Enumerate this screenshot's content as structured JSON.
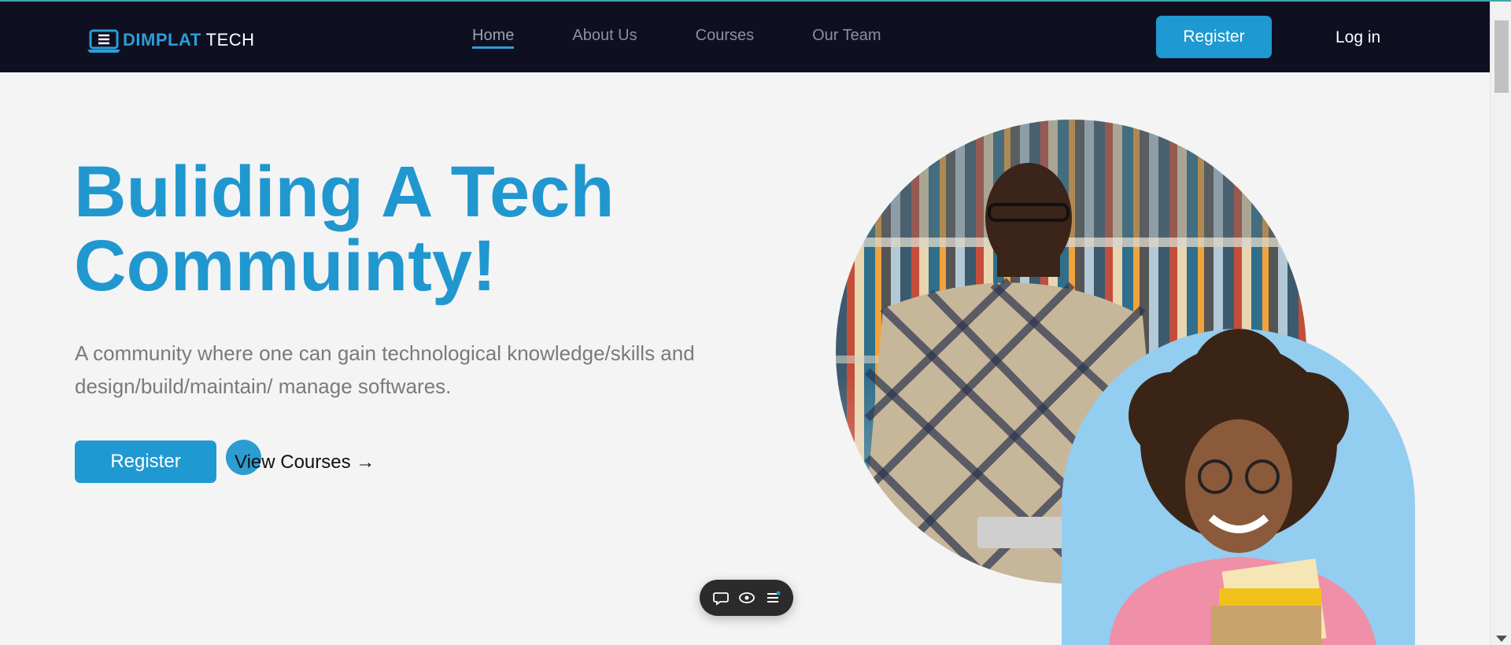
{
  "header": {
    "logo": {
      "word1": "DIMPLAT",
      "word2": "TECH"
    },
    "nav": [
      {
        "label": "Home",
        "active": true
      },
      {
        "label": "About Us"
      },
      {
        "label": "Courses"
      },
      {
        "label": "Our Team"
      }
    ],
    "register_label": "Register",
    "login_label": "Log in"
  },
  "hero": {
    "title_line1": "Buliding A Tech",
    "title_line2": "Commuinty!",
    "description": "A community where one can gain technological knowledge/skills and design/build/maintain/ manage softwares.",
    "register_label": "Register",
    "view_courses_label": "View Courses →"
  },
  "floating_toolbar": {
    "icons": [
      "chat-icon",
      "eye-icon",
      "menu-icon"
    ]
  },
  "colors": {
    "accent": "#2197cf",
    "navbar": "#0e0f21",
    "background": "#f4f4f4"
  }
}
